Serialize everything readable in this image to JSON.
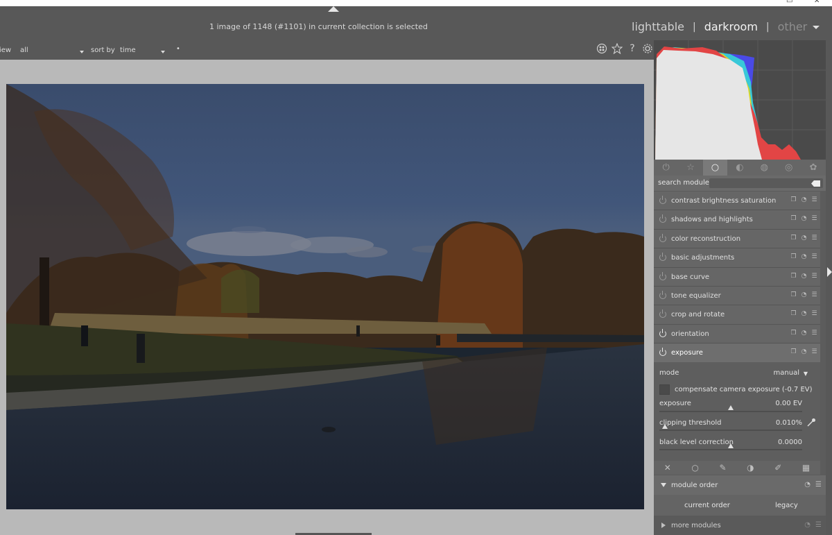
{
  "window": {
    "minimize_glyph": "▭",
    "close_glyph": "✕"
  },
  "header": {
    "status": "1 image of 1148 (#1101) in current collection is selected",
    "views": [
      {
        "label": "lighttable",
        "state": "inactive"
      },
      {
        "label": "darkroom",
        "state": "active"
      },
      {
        "label": "other",
        "state": "dim"
      }
    ],
    "separator": "|"
  },
  "filterbar": {
    "view_label": "view",
    "view_value": "all",
    "sort_label": "sort by",
    "sort_value": "time",
    "order_glyph": "•",
    "icons": [
      "grouping-icon",
      "star-icon",
      "help-icon",
      "preferences-icon"
    ]
  },
  "panel": {
    "group_tabs": [
      "power-icon",
      "star-icon",
      "circle-icon",
      "half-circle-icon",
      "color-icon",
      "correct-icon",
      "effect-icon"
    ],
    "active_group": 2,
    "search_label": "search module",
    "modules": [
      {
        "name": "contrast brightness saturation",
        "enabled": false
      },
      {
        "name": "shadows and highlights",
        "enabled": false
      },
      {
        "name": "color reconstruction",
        "enabled": false
      },
      {
        "name": "basic adjustments",
        "enabled": false
      },
      {
        "name": "base curve",
        "enabled": false
      },
      {
        "name": "tone equalizer",
        "enabled": false
      },
      {
        "name": "crop and rotate",
        "enabled": false
      },
      {
        "name": "orientation",
        "enabled": true
      },
      {
        "name": "exposure",
        "enabled": true,
        "expanded": true
      }
    ],
    "exposure": {
      "mode_label": "mode",
      "mode_value": "manual",
      "compensate_label": "compensate camera exposure (-0.7 EV)",
      "exposure_label": "exposure",
      "exposure_value": "0.00 EV",
      "exposure_position": 0.5,
      "clip_label": "clipping threshold",
      "clip_value": "0.010%",
      "clip_position": 0.02,
      "black_label": "black level correction",
      "black_value": "0.0000",
      "black_position": 0.5
    },
    "mask_icons": [
      "mask-off-icon",
      "uniform-mask-icon",
      "drawn-mask-icon",
      "parametric-mask-icon",
      "drawn-parametric-mask-icon",
      "raster-mask-icon"
    ],
    "module_order": {
      "title": "module order",
      "current": "current order",
      "legacy": "legacy"
    },
    "more_modules": "more modules"
  }
}
